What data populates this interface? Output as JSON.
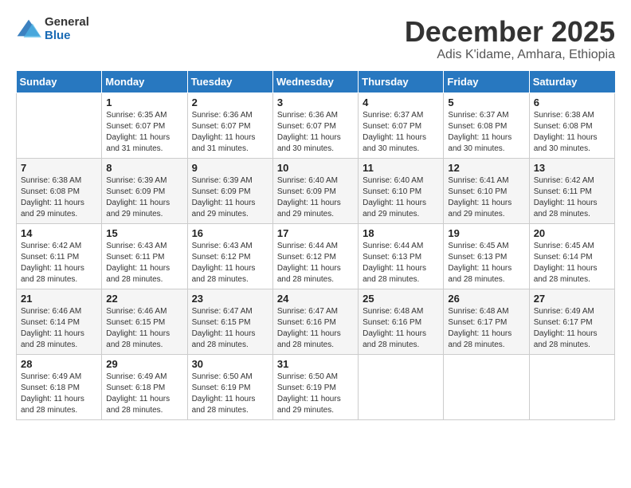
{
  "logo": {
    "general": "General",
    "blue": "Blue"
  },
  "header": {
    "month": "December 2025",
    "location": "Adis K'idame, Amhara, Ethiopia"
  },
  "weekdays": [
    "Sunday",
    "Monday",
    "Tuesday",
    "Wednesday",
    "Thursday",
    "Friday",
    "Saturday"
  ],
  "weeks": [
    [
      {
        "day": "",
        "sunrise": "",
        "sunset": "",
        "daylight": ""
      },
      {
        "day": "1",
        "sunrise": "Sunrise: 6:35 AM",
        "sunset": "Sunset: 6:07 PM",
        "daylight": "Daylight: 11 hours and 31 minutes."
      },
      {
        "day": "2",
        "sunrise": "Sunrise: 6:36 AM",
        "sunset": "Sunset: 6:07 PM",
        "daylight": "Daylight: 11 hours and 31 minutes."
      },
      {
        "day": "3",
        "sunrise": "Sunrise: 6:36 AM",
        "sunset": "Sunset: 6:07 PM",
        "daylight": "Daylight: 11 hours and 30 minutes."
      },
      {
        "day": "4",
        "sunrise": "Sunrise: 6:37 AM",
        "sunset": "Sunset: 6:07 PM",
        "daylight": "Daylight: 11 hours and 30 minutes."
      },
      {
        "day": "5",
        "sunrise": "Sunrise: 6:37 AM",
        "sunset": "Sunset: 6:08 PM",
        "daylight": "Daylight: 11 hours and 30 minutes."
      },
      {
        "day": "6",
        "sunrise": "Sunrise: 6:38 AM",
        "sunset": "Sunset: 6:08 PM",
        "daylight": "Daylight: 11 hours and 30 minutes."
      }
    ],
    [
      {
        "day": "7",
        "sunrise": "Sunrise: 6:38 AM",
        "sunset": "Sunset: 6:08 PM",
        "daylight": "Daylight: 11 hours and 29 minutes."
      },
      {
        "day": "8",
        "sunrise": "Sunrise: 6:39 AM",
        "sunset": "Sunset: 6:09 PM",
        "daylight": "Daylight: 11 hours and 29 minutes."
      },
      {
        "day": "9",
        "sunrise": "Sunrise: 6:39 AM",
        "sunset": "Sunset: 6:09 PM",
        "daylight": "Daylight: 11 hours and 29 minutes."
      },
      {
        "day": "10",
        "sunrise": "Sunrise: 6:40 AM",
        "sunset": "Sunset: 6:09 PM",
        "daylight": "Daylight: 11 hours and 29 minutes."
      },
      {
        "day": "11",
        "sunrise": "Sunrise: 6:40 AM",
        "sunset": "Sunset: 6:10 PM",
        "daylight": "Daylight: 11 hours and 29 minutes."
      },
      {
        "day": "12",
        "sunrise": "Sunrise: 6:41 AM",
        "sunset": "Sunset: 6:10 PM",
        "daylight": "Daylight: 11 hours and 29 minutes."
      },
      {
        "day": "13",
        "sunrise": "Sunrise: 6:42 AM",
        "sunset": "Sunset: 6:11 PM",
        "daylight": "Daylight: 11 hours and 28 minutes."
      }
    ],
    [
      {
        "day": "14",
        "sunrise": "Sunrise: 6:42 AM",
        "sunset": "Sunset: 6:11 PM",
        "daylight": "Daylight: 11 hours and 28 minutes."
      },
      {
        "day": "15",
        "sunrise": "Sunrise: 6:43 AM",
        "sunset": "Sunset: 6:11 PM",
        "daylight": "Daylight: 11 hours and 28 minutes."
      },
      {
        "day": "16",
        "sunrise": "Sunrise: 6:43 AM",
        "sunset": "Sunset: 6:12 PM",
        "daylight": "Daylight: 11 hours and 28 minutes."
      },
      {
        "day": "17",
        "sunrise": "Sunrise: 6:44 AM",
        "sunset": "Sunset: 6:12 PM",
        "daylight": "Daylight: 11 hours and 28 minutes."
      },
      {
        "day": "18",
        "sunrise": "Sunrise: 6:44 AM",
        "sunset": "Sunset: 6:13 PM",
        "daylight": "Daylight: 11 hours and 28 minutes."
      },
      {
        "day": "19",
        "sunrise": "Sunrise: 6:45 AM",
        "sunset": "Sunset: 6:13 PM",
        "daylight": "Daylight: 11 hours and 28 minutes."
      },
      {
        "day": "20",
        "sunrise": "Sunrise: 6:45 AM",
        "sunset": "Sunset: 6:14 PM",
        "daylight": "Daylight: 11 hours and 28 minutes."
      }
    ],
    [
      {
        "day": "21",
        "sunrise": "Sunrise: 6:46 AM",
        "sunset": "Sunset: 6:14 PM",
        "daylight": "Daylight: 11 hours and 28 minutes."
      },
      {
        "day": "22",
        "sunrise": "Sunrise: 6:46 AM",
        "sunset": "Sunset: 6:15 PM",
        "daylight": "Daylight: 11 hours and 28 minutes."
      },
      {
        "day": "23",
        "sunrise": "Sunrise: 6:47 AM",
        "sunset": "Sunset: 6:15 PM",
        "daylight": "Daylight: 11 hours and 28 minutes."
      },
      {
        "day": "24",
        "sunrise": "Sunrise: 6:47 AM",
        "sunset": "Sunset: 6:16 PM",
        "daylight": "Daylight: 11 hours and 28 minutes."
      },
      {
        "day": "25",
        "sunrise": "Sunrise: 6:48 AM",
        "sunset": "Sunset: 6:16 PM",
        "daylight": "Daylight: 11 hours and 28 minutes."
      },
      {
        "day": "26",
        "sunrise": "Sunrise: 6:48 AM",
        "sunset": "Sunset: 6:17 PM",
        "daylight": "Daylight: 11 hours and 28 minutes."
      },
      {
        "day": "27",
        "sunrise": "Sunrise: 6:49 AM",
        "sunset": "Sunset: 6:17 PM",
        "daylight": "Daylight: 11 hours and 28 minutes."
      }
    ],
    [
      {
        "day": "28",
        "sunrise": "Sunrise: 6:49 AM",
        "sunset": "Sunset: 6:18 PM",
        "daylight": "Daylight: 11 hours and 28 minutes."
      },
      {
        "day": "29",
        "sunrise": "Sunrise: 6:49 AM",
        "sunset": "Sunset: 6:18 PM",
        "daylight": "Daylight: 11 hours and 28 minutes."
      },
      {
        "day": "30",
        "sunrise": "Sunrise: 6:50 AM",
        "sunset": "Sunset: 6:19 PM",
        "daylight": "Daylight: 11 hours and 28 minutes."
      },
      {
        "day": "31",
        "sunrise": "Sunrise: 6:50 AM",
        "sunset": "Sunset: 6:19 PM",
        "daylight": "Daylight: 11 hours and 29 minutes."
      },
      {
        "day": "",
        "sunrise": "",
        "sunset": "",
        "daylight": ""
      },
      {
        "day": "",
        "sunrise": "",
        "sunset": "",
        "daylight": ""
      },
      {
        "day": "",
        "sunrise": "",
        "sunset": "",
        "daylight": ""
      }
    ]
  ]
}
